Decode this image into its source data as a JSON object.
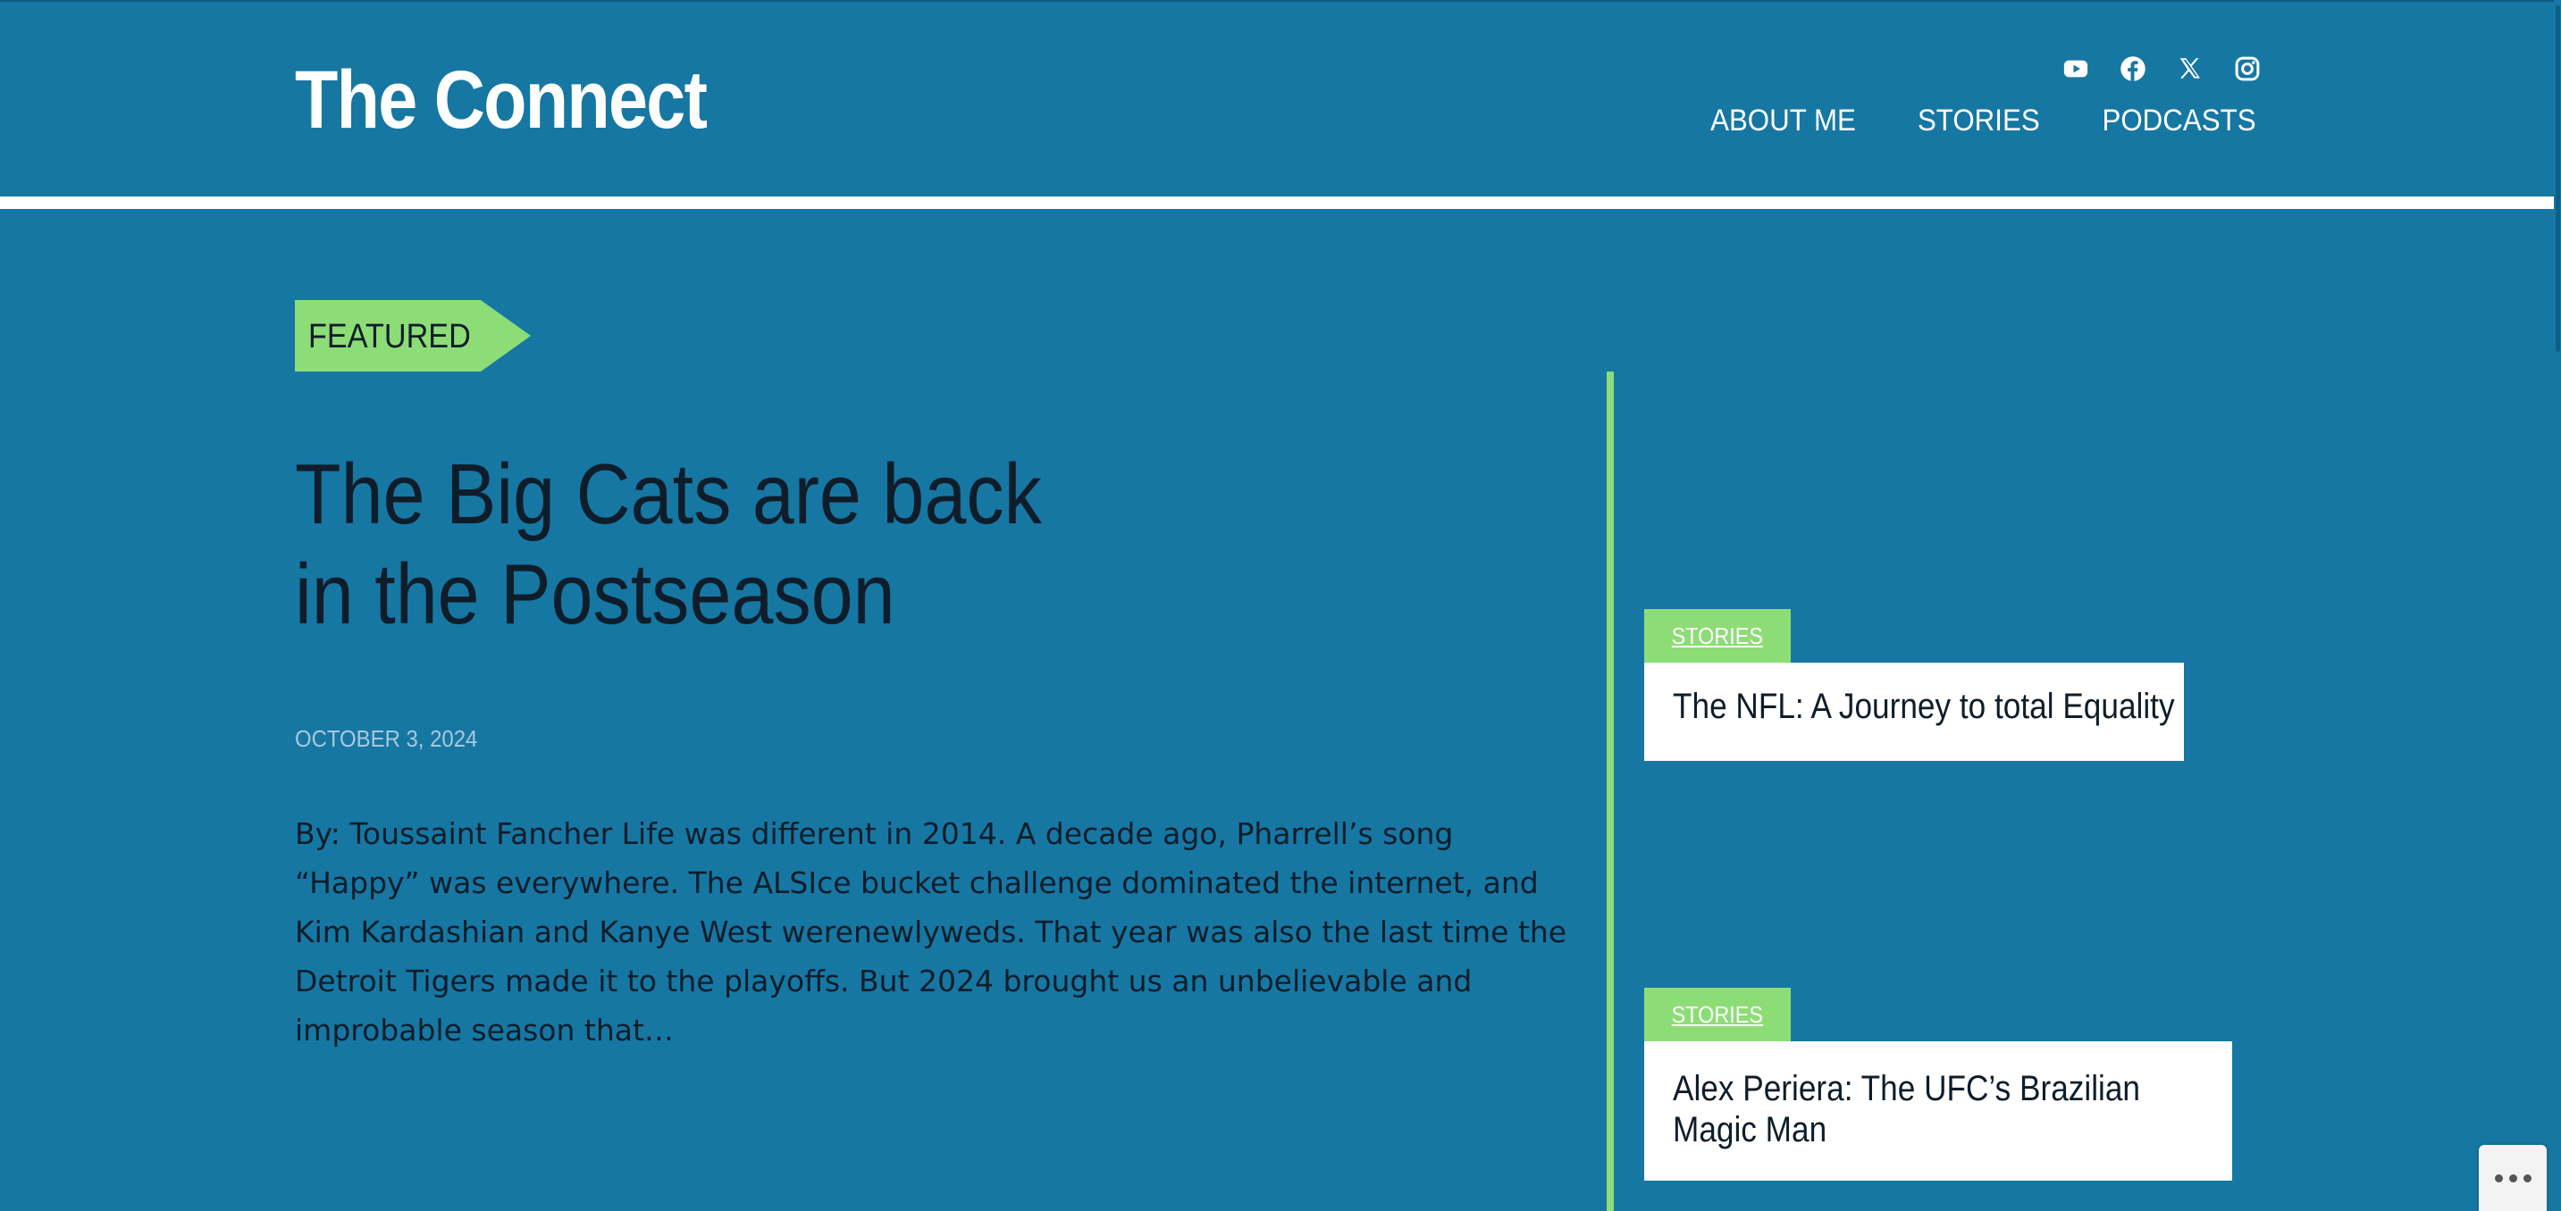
{
  "header": {
    "site_title": "The Connect",
    "social_icons": [
      "youtube-icon",
      "facebook-icon",
      "x-icon",
      "instagram-icon"
    ],
    "nav": [
      "ABOUT ME",
      "STORIES",
      "PODCASTS"
    ]
  },
  "featured": {
    "tag": "FEATURED",
    "title": "The Big Cats are back in the Postseason",
    "date": "OCTOBER 3, 2024",
    "excerpt": "By: Toussaint Fancher Life was different in 2014. A decade ago, Pharrell’s song “Happy” was everywhere. The ALSIce bucket challenge dominated the internet, and Kim Kardashian and Kanye West werenewlyweds. That year was also the last time the Detroit Tigers made it to the playoffs. But 2024 brought us an unbelievable and improbable season that…"
  },
  "side_posts": [
    {
      "category": "STORIES",
      "title": "The NFL: A Journey to total Equality"
    },
    {
      "category": "STORIES",
      "title": "Alex Periera: The UFC’s Brazilian Magic Man"
    }
  ],
  "colors": {
    "background": "#1677a3",
    "accent_green": "#8ddd76",
    "text_dark": "#0f1d2a",
    "white": "#ffffff"
  }
}
